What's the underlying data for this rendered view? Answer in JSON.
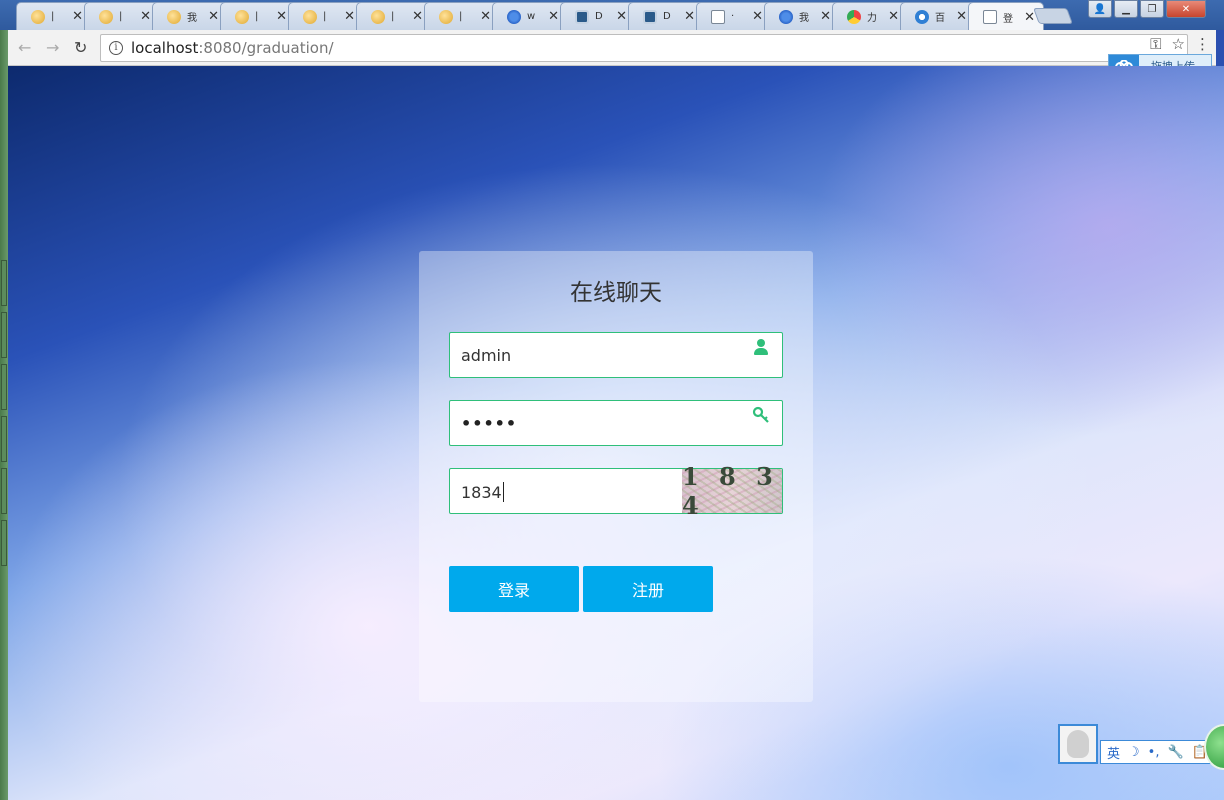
{
  "browser": {
    "tabs": [
      {
        "favicon": "pig-icon",
        "title": "|"
      },
      {
        "favicon": "pig-icon",
        "title": "|"
      },
      {
        "favicon": "pig-icon",
        "title": "我"
      },
      {
        "favicon": "pig-icon",
        "title": "|"
      },
      {
        "favicon": "pig-icon",
        "title": "|"
      },
      {
        "favicon": "pig-icon",
        "title": "|"
      },
      {
        "favicon": "pig-icon",
        "title": "|"
      },
      {
        "favicon": "baidu-paw-icon",
        "title": "w"
      },
      {
        "favicon": "grid-doc-icon",
        "title": "D"
      },
      {
        "favicon": "grid-doc-icon",
        "title": "D"
      },
      {
        "favicon": "doc-icon",
        "title": "·"
      },
      {
        "favicon": "baidu-paw-icon",
        "title": "我"
      },
      {
        "favicon": "chrome-icon",
        "title": "力"
      },
      {
        "favicon": "cloud-icon",
        "title": "百"
      },
      {
        "favicon": "doc-icon",
        "title": "登"
      }
    ],
    "tab_close_glyph": "✕",
    "url_host": "localhost",
    "url_path": ":8080/graduation/",
    "upload_label": "拖拽上传"
  },
  "login": {
    "title": "在线聊天",
    "username_value": "admin",
    "password_mask": "•••••",
    "captcha_value": "1834",
    "captcha_image_text": "1 8 3 4",
    "login_label": "登录",
    "register_label": "注册"
  },
  "ime": {
    "lang": "英",
    "moon": "☽",
    "punct": "•,",
    "wrench": "🔧",
    "clip": "📋",
    "smile": "☺"
  },
  "colors": {
    "accent_button": "#00a9ec",
    "field_border": "#2fbf7a"
  }
}
